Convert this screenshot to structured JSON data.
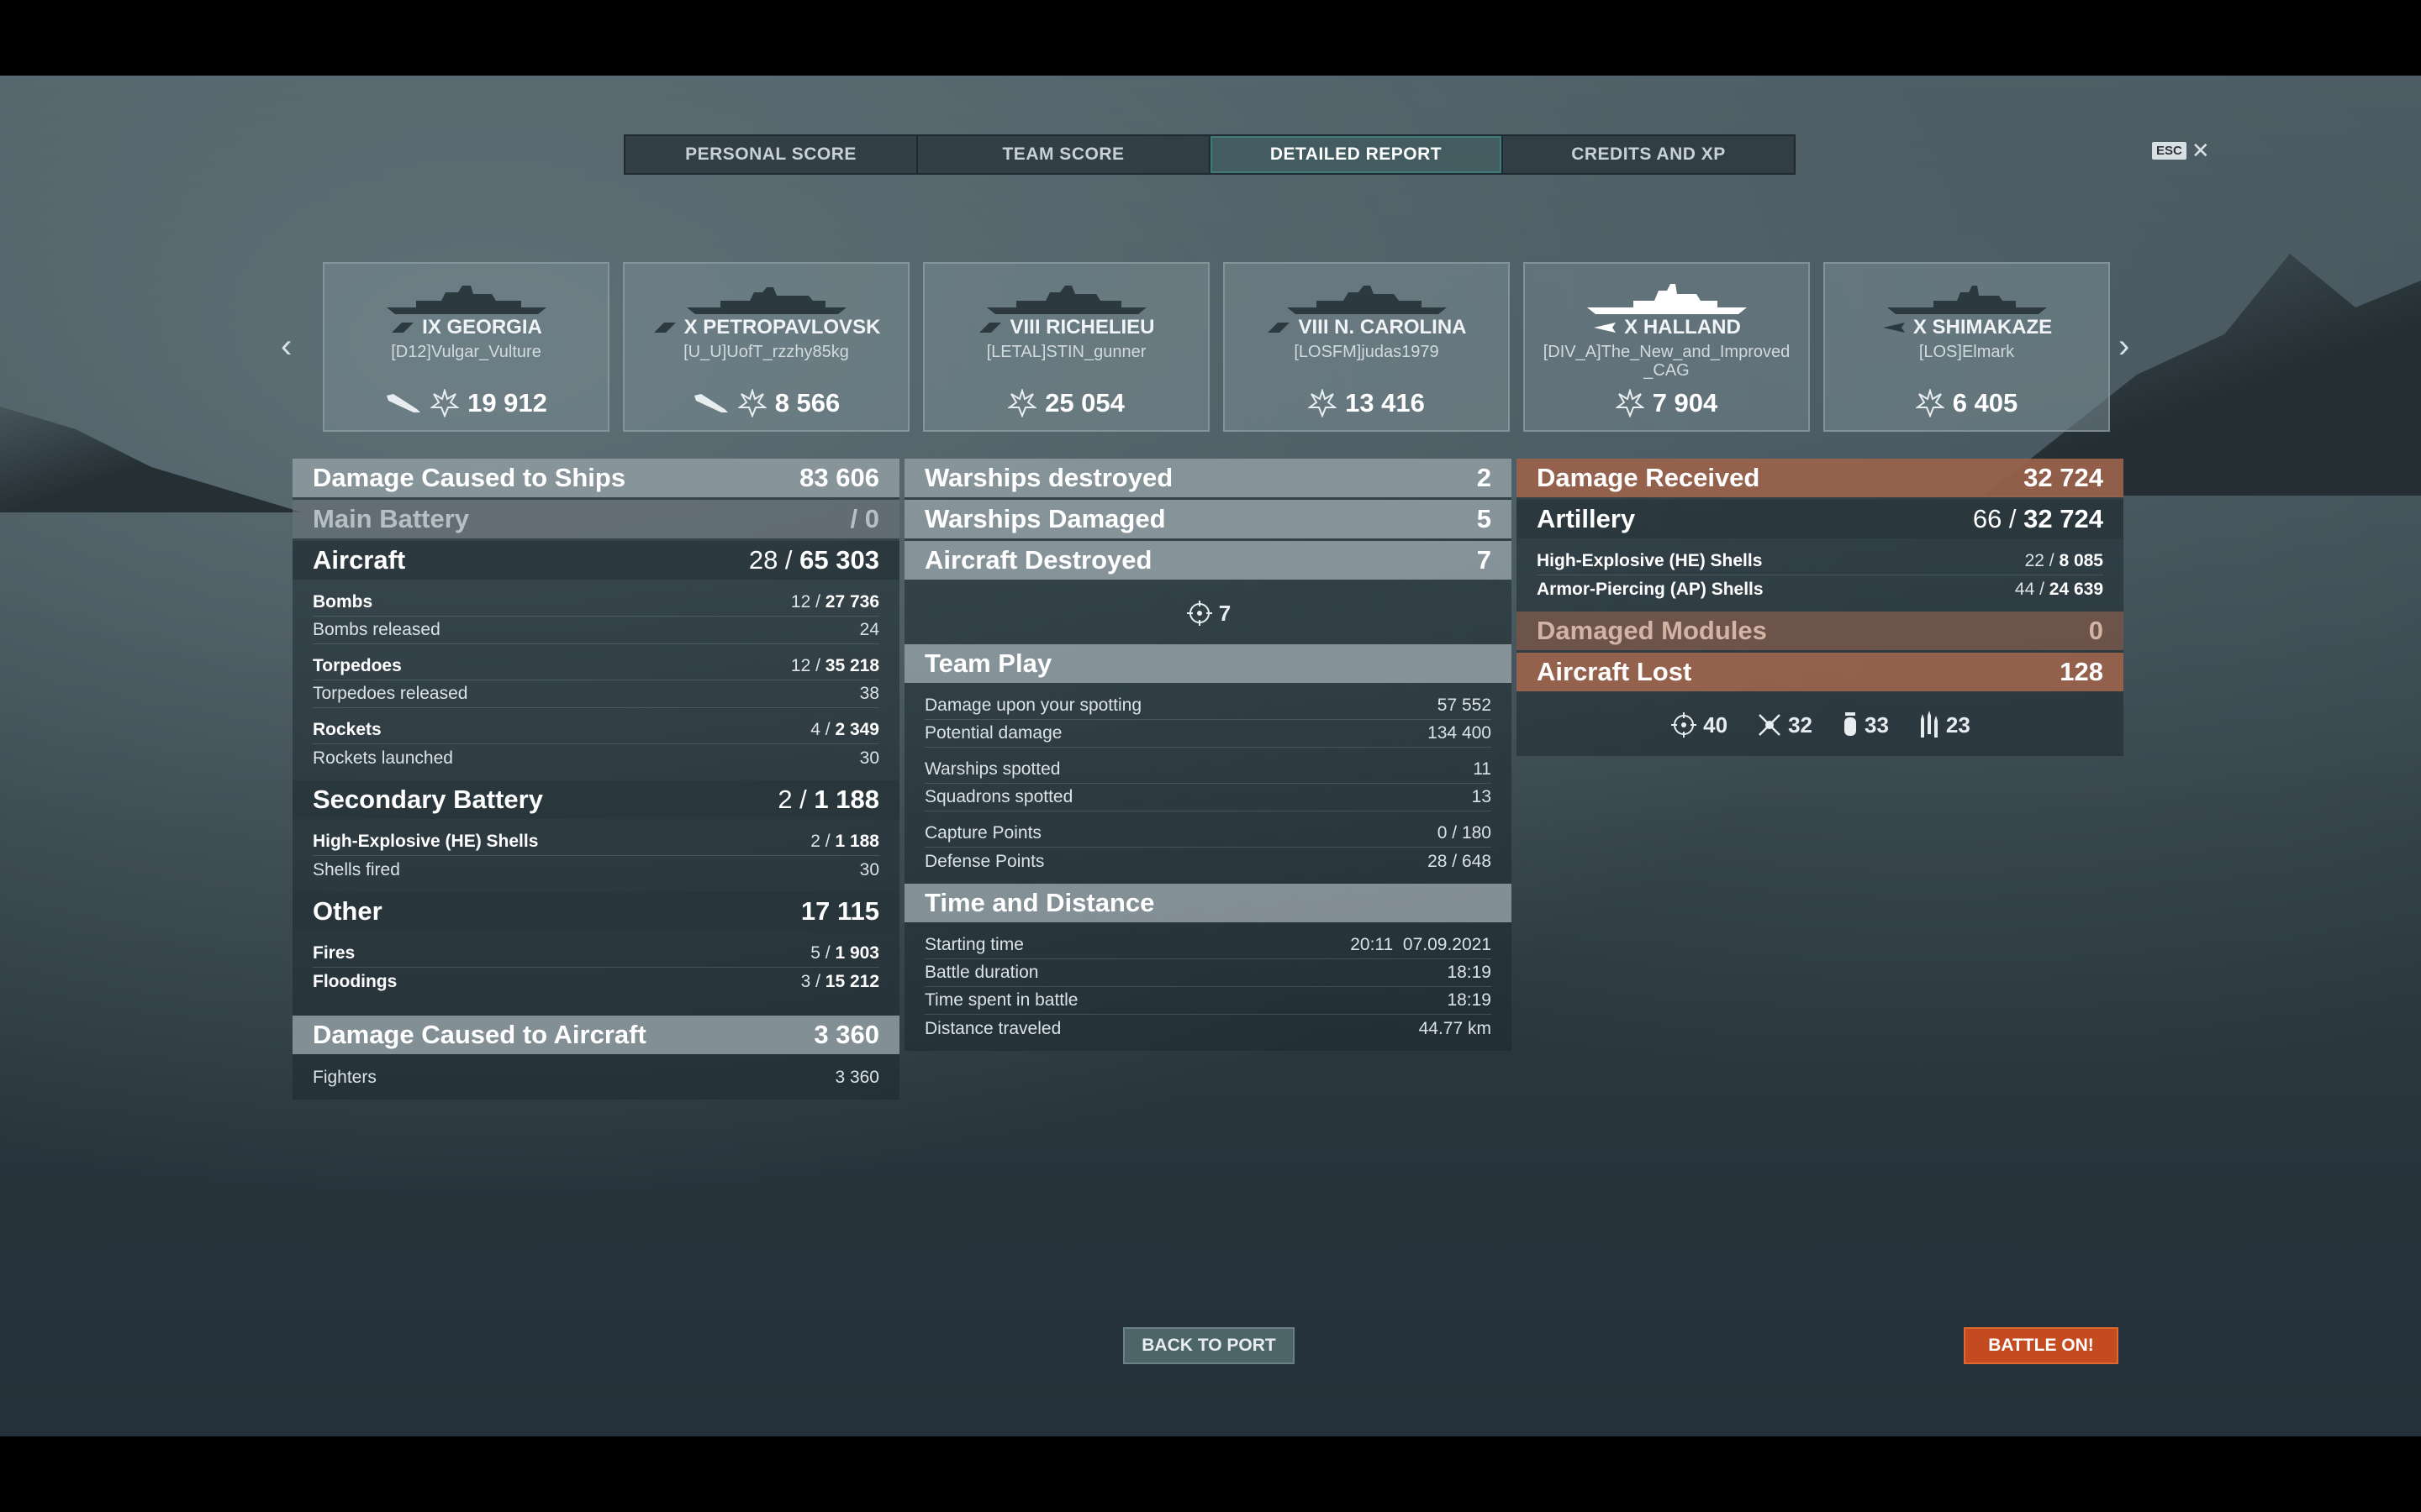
{
  "tabs": [
    {
      "label": "PERSONAL SCORE"
    },
    {
      "label": "TEAM SCORE"
    },
    {
      "label": "DETAILED REPORT",
      "active": true
    },
    {
      "label": "CREDITS AND XP"
    }
  ],
  "esc": {
    "key": "ESC",
    "close": "✕"
  },
  "ships": [
    {
      "name": "IX GEORGIA",
      "player": "[D12]Vulgar_Vulture",
      "damage": "19 912",
      "plane": true
    },
    {
      "name": "X PETROPAVLOVSK",
      "player": "[U_U]UofT_rzzhy85kg",
      "damage": "8 566",
      "plane": true
    },
    {
      "name": "VIII RICHELIEU",
      "player": "[LETAL]STIN_gunner",
      "damage": "25 054"
    },
    {
      "name": "VIII N. CAROLINA",
      "player": "[LOSFM]judas1979",
      "damage": "13 416"
    },
    {
      "name": "X HALLAND",
      "player": "[DIV_A]The_New_and_Improved_CAG",
      "damage": "7 904",
      "active": true
    },
    {
      "name": "X SHIMAKAZE",
      "player": "[LOS]Elmark",
      "damage": "6 405"
    }
  ],
  "damage_ships": {
    "title": "Damage Caused to Ships",
    "value": "83 606",
    "main_battery": {
      "label": "Main Battery",
      "value": "/ 0"
    },
    "aircraft": {
      "label": "Aircraft",
      "hits": "28 /",
      "value": "65 303"
    },
    "aircraft_rows": [
      {
        "label": "Bombs",
        "hits": "12 /",
        "value": "27 736",
        "bold": true
      },
      {
        "label": "Bombs released",
        "value": "24"
      },
      {
        "label": "Torpedoes",
        "hits": "12 /",
        "value": "35 218",
        "bold": true
      },
      {
        "label": "Torpedoes released",
        "value": "38"
      },
      {
        "label": "Rockets",
        "hits": "4 /",
        "value": "2 349",
        "bold": true
      },
      {
        "label": "Rockets launched",
        "value": "30"
      }
    ],
    "secondary": {
      "label": "Secondary Battery",
      "hits": "2 /",
      "value": "1 188"
    },
    "secondary_rows": [
      {
        "label": "High-Explosive (HE) Shells",
        "hits": "2 /",
        "value": "1 188"
      },
      {
        "label": "Shells fired",
        "value": "30"
      }
    ],
    "other": {
      "label": "Other",
      "value": "17 115"
    },
    "other_rows": [
      {
        "label": "Fires",
        "hits": "5 /",
        "value": "1 903"
      },
      {
        "label": "Floodings",
        "hits": "3 /",
        "value": "15 212"
      }
    ]
  },
  "damage_aircraft": {
    "title": "Damage Caused to Aircraft",
    "value": "3 360",
    "fighters_label": "Fighters",
    "fighters_value": "3 360"
  },
  "middle": {
    "warships_destroyed": {
      "label": "Warships destroyed",
      "value": "2"
    },
    "warships_damaged": {
      "label": "Warships Damaged",
      "value": "5"
    },
    "aircraft_destroyed": {
      "label": "Aircraft Destroyed",
      "value": "7"
    },
    "aircraft_icon_count": "7",
    "team_play": {
      "title": "Team Play",
      "rows": [
        {
          "label": "Damage upon your spotting",
          "value": "57 552"
        },
        {
          "label": "Potential damage",
          "value": "134 400"
        },
        {
          "label": "Warships spotted",
          "value": "11"
        },
        {
          "label": "Squadrons spotted",
          "value": "13"
        },
        {
          "label": "Capture Points",
          "value": "0 / 180"
        },
        {
          "label": "Defense Points",
          "value": "28 / 648"
        }
      ]
    },
    "time": {
      "title": "Time and Distance",
      "rows": [
        {
          "label": "Starting time",
          "value": "20:11  07.09.2021"
        },
        {
          "label": "Battle duration",
          "value": "18:19"
        },
        {
          "label": "Time spent in battle",
          "value": "18:19"
        },
        {
          "label": "Distance traveled",
          "value": "44.77 km"
        }
      ]
    }
  },
  "received": {
    "title": "Damage Received",
    "value": "32 724",
    "artillery": {
      "label": "Artillery",
      "hits": "66 /",
      "value": "32 724"
    },
    "rows": [
      {
        "label": "High-Explosive (HE) Shells",
        "hits": "22 /",
        "value": "8 085"
      },
      {
        "label": "Armor-Piercing (AP) Shells",
        "hits": "44 /",
        "value": "24 639"
      }
    ],
    "modules": {
      "label": "Damaged Modules",
      "value": "0"
    },
    "aircraft_lost": {
      "label": "Aircraft Lost",
      "value": "128"
    },
    "icon_counts": {
      "crosshair": "40",
      "shotdown": "32",
      "bomb": "33",
      "rockets": "23"
    }
  },
  "buttons": {
    "back": "BACK TO PORT",
    "battle": "BATTLE ON!"
  },
  "colors": {
    "accent": "#c44a1f",
    "received_header": "#a6684e",
    "tab_active": "#3f7b7b"
  }
}
